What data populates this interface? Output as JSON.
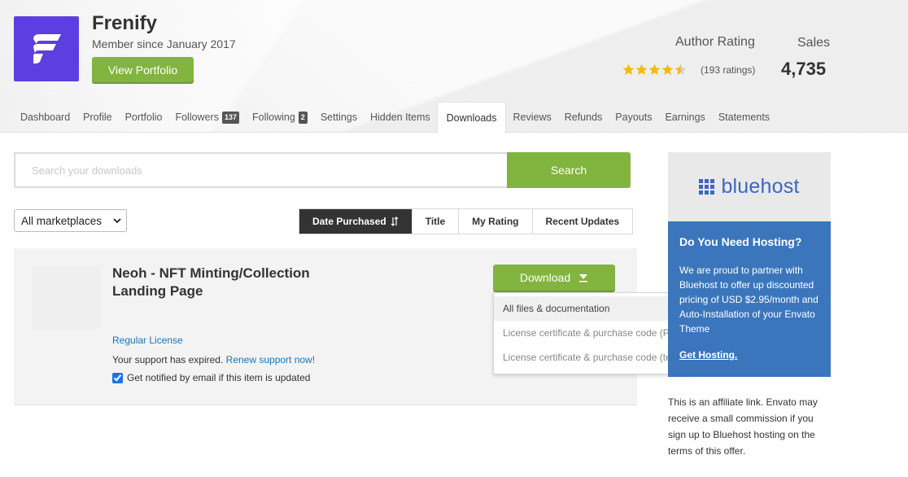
{
  "author": {
    "name": "Frenify",
    "member_since": "Member since January 2017",
    "view_portfolio_label": "View Portfolio"
  },
  "stats": {
    "rating_label": "Author Rating",
    "rating_value": 4.5,
    "ratings_count": "(193 ratings)",
    "sales_label": "Sales",
    "sales_value": "4,735",
    "star_color": "#f5b90d"
  },
  "tabs": [
    {
      "label": "Dashboard"
    },
    {
      "label": "Profile"
    },
    {
      "label": "Portfolio"
    },
    {
      "label": "Followers",
      "badge": "137"
    },
    {
      "label": "Following",
      "badge": "2"
    },
    {
      "label": "Settings"
    },
    {
      "label": "Hidden Items"
    },
    {
      "label": "Downloads",
      "active": true
    },
    {
      "label": "Reviews"
    },
    {
      "label": "Refunds"
    },
    {
      "label": "Payouts"
    },
    {
      "label": "Earnings"
    },
    {
      "label": "Statements"
    }
  ],
  "search": {
    "placeholder": "Search your downloads",
    "value": "",
    "button_label": "Search"
  },
  "filters": {
    "marketplace_selected": "All marketplaces",
    "sort_options": [
      {
        "label": "Date Purchased",
        "active": true,
        "icon": "sort-icon"
      },
      {
        "label": "Title"
      },
      {
        "label": "My Rating"
      },
      {
        "label": "Recent Updates"
      }
    ]
  },
  "item": {
    "title": "Neoh - NFT Minting/Collection Landing Page",
    "license": "Regular License",
    "support_text": "Your support has expired.",
    "renew_link": "Renew support now!",
    "notify_label": "Get notified by email if this item is updated",
    "notify_checked": true,
    "download_label": "Download",
    "download_options": [
      "All files & documentation",
      "License certificate & purchase code (PDF)",
      "License certificate & purchase code (text)"
    ]
  },
  "ad": {
    "brand": "bluehost",
    "heading": "Do You Need Hosting?",
    "body": "We are proud to partner with Bluehost to offer up discounted pricing of USD $2.95/month and Auto-Installation of your Envato Theme",
    "link": "Get Hosting",
    "link_suffix": ".",
    "disclaimer": "This is an affiliate link. Envato may receive a small commission if you sign up to Bluehost hosting on the terms of this offer."
  },
  "colors": {
    "accent_green": "#82b440",
    "logo_purple": "#5b3fe0",
    "ad_blue": "#3b76bd",
    "link_blue": "#1a75b3"
  }
}
